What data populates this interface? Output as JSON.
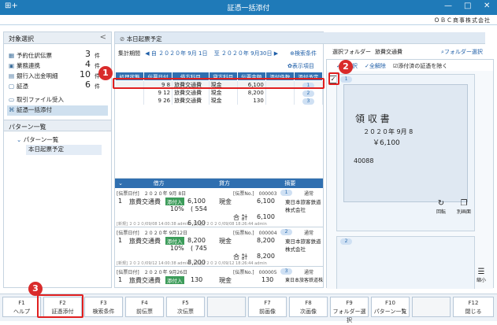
{
  "window": {
    "title": "証憑一括添付",
    "company": "ＯＢＣ商事株式会社",
    "min": "—",
    "max": "□",
    "close": "✕",
    "app_icon": "⊞+"
  },
  "left": {
    "header": "対象選択",
    "collapse": "<",
    "items": [
      {
        "label": "予約仕訳伝票",
        "count": "3",
        "unit": "件",
        "icon": "calendar-icon"
      },
      {
        "label": "業務連携",
        "count": "4",
        "unit": "件",
        "icon": "link-icon"
      },
      {
        "label": "銀行入出金明細",
        "count": "10",
        "unit": "件",
        "icon": "bank-icon"
      },
      {
        "label": "証憑",
        "count": "6",
        "unit": "件",
        "icon": "doc-icon"
      },
      {
        "label": "取引ファイル受入",
        "icon": "file-import-icon"
      },
      {
        "label": "証憑一括添付",
        "icon": "attach-icon"
      }
    ],
    "pattern_header": "パターン一覧",
    "tree_root": "パターン一覧",
    "tree_child": "本日起票予定"
  },
  "center": {
    "title": "本日起票予定",
    "period_label": "集計期間",
    "period_from": "自 ２０２０年 9月 1日",
    "period_to": "至 ２０２０年 9月30日",
    "search_link": "検索条件",
    "display_link": "表示項目",
    "columns": [
      "処理状態",
      "伝票日付",
      "借方科目",
      "貸方科目",
      "伝票金額",
      "添付件数",
      "添付予定"
    ],
    "rows": [
      {
        "date": "9 8",
        "debit": "旅費交通費",
        "credit": "現金",
        "amount": "6,100",
        "count": "",
        "plan": "1"
      },
      {
        "date": "9 12",
        "debit": "旅費交通費",
        "credit": "現金",
        "amount": "8,200",
        "count": "",
        "plan": "2"
      },
      {
        "date": "9 26",
        "debit": "旅費交通費",
        "credit": "現金",
        "amount": "130",
        "count": "",
        "plan": "3"
      }
    ],
    "detail_cols": [
      "借方",
      "貸方",
      "摘要"
    ],
    "details": [
      {
        "head": "[伝票日付]　２０２０年 9月 8日",
        "voucher": "[伝票No.]　000003",
        "plan": "1",
        "kind": "通常",
        "line": "1",
        "debit": "旅費交通費",
        "tag": "添付入",
        "amt": "6,100",
        "rate": "10%",
        "tax": "( 554",
        "credit": "現金",
        "camt": "6,100",
        "memo": "東日本旅客鉄道株式会社",
        "total_label": "合 計",
        "debit_total": "6,100",
        "credit_total": "6,100",
        "footer": "[新規] ２０２０/09/08 14:00:38 admin　[修正] ２０２０/09/08 18:26:44 admin"
      },
      {
        "head": "[伝票日付]　２０２０年 9月12日",
        "voucher": "[伝票No.]　000004",
        "plan": "2",
        "kind": "通常",
        "line": "1",
        "debit": "旅費交通費",
        "tag": "添付入",
        "amt": "8,200",
        "rate": "10%",
        "tax": "( 745",
        "credit": "現金",
        "camt": "8,200",
        "memo": "東日本旅客鉄道株式会社",
        "total_label": "合 計",
        "debit_total": "8,200",
        "credit_total": "8,200",
        "footer": "[新規] ２０２０/09/12 14:00:38 admin　[修正] ２０２０/09/12 18:26:44 admin"
      },
      {
        "head": "[伝票日付]　２０２０年 9月26日",
        "voucher": "[伝票No.]　000005",
        "plan": "3",
        "kind": "通常",
        "line": "1",
        "debit": "旅費交通費",
        "tag": "添付入",
        "amt": "130",
        "credit": "現金",
        "camt": "130",
        "memo": "東日本旅客鉄道株式会社"
      }
    ]
  },
  "right": {
    "folder_label": "選択フォルダー",
    "folder_name": "旅費交通費",
    "folder_select": "フォルダー選択",
    "select_all": "全選択",
    "deselect_all": "全解除",
    "exclude_label": "添付済の証憑を除く",
    "thumb1_num": "1",
    "thumb2_num": "2",
    "receipt_title": "領 収 書",
    "receipt_date": "２０２０年 9月 8",
    "receipt_amount": "￥6,100",
    "receipt_number": "40088",
    "rotate": "回転",
    "separate": "別画面",
    "shrink": "縮小"
  },
  "callouts": [
    "1",
    "2",
    "3"
  ],
  "fkeys": [
    {
      "key": "F1",
      "label": "ヘルプ"
    },
    {
      "key": "F2",
      "label": "証憑添付"
    },
    {
      "key": "F3",
      "label": "検索条件"
    },
    {
      "key": "F4",
      "label": "前伝票"
    },
    {
      "key": "F5",
      "label": "次伝票"
    },
    {
      "key": "",
      "label": ""
    },
    {
      "key": "F7",
      "label": "前画像"
    },
    {
      "key": "F8",
      "label": "次画像"
    },
    {
      "key": "F9",
      "label": "フォルダー選択"
    },
    {
      "key": "F10",
      "label": "パターン一覧"
    },
    {
      "key": "",
      "label": ""
    },
    {
      "key": "F12",
      "label": "閉じる"
    }
  ],
  "colors": {
    "accent": "#1f7ab8",
    "header": "#2f6fb0",
    "callout": "#d92b2b"
  }
}
